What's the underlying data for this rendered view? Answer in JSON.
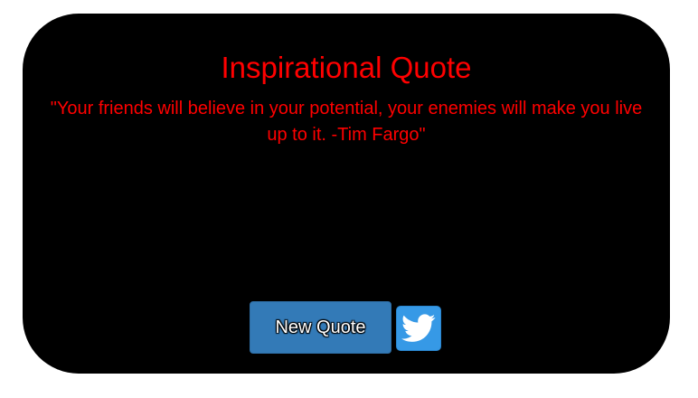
{
  "quote_card": {
    "title": "Inspirational Quote",
    "quote_text": "\"Your friends will believe in your potential, your enemies will make you live up to it. -Tim Fargo\"",
    "new_quote_label": "New Quote",
    "tweet_icon": "twitter-bird-icon"
  },
  "colors": {
    "card_background": "#000000",
    "text": "#ff0000",
    "new_quote_button": "#337ab7",
    "tweet_button": "#3699e6"
  }
}
